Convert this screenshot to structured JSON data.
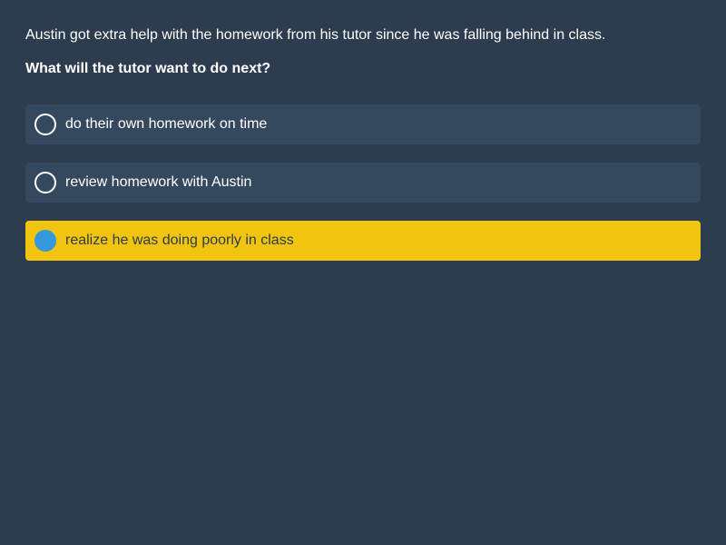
{
  "context": "Austin got extra help with the homework from his tutor since he was falling behind in class.",
  "question": "What will the tutor want to do next?",
  "options": [
    {
      "label": "do their own homework on time",
      "selected": false
    },
    {
      "label": "review homework with Austin",
      "selected": false
    },
    {
      "label": "realize he was doing poorly in class",
      "selected": true
    }
  ],
  "colors": {
    "background": "#2d3c4f",
    "option_background": "#34495e",
    "selected_background": "#f1c40f",
    "selected_radio": "#3498db"
  }
}
